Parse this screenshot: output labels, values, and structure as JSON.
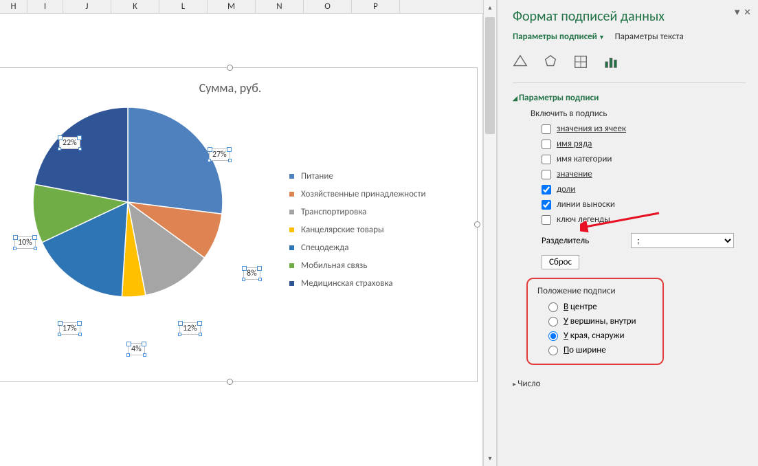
{
  "columns": [
    "H",
    "I",
    "J",
    "K",
    "L",
    "M",
    "N",
    "O",
    "P"
  ],
  "chart_data": {
    "type": "pie",
    "title": "Сумма, руб.",
    "series": [
      {
        "name": "Питание",
        "value": 27,
        "color": "#4e81bd"
      },
      {
        "name": "Хозяйственные принадлежности",
        "value": 8,
        "color": "#dd8452"
      },
      {
        "name": "Транспортировка",
        "value": 12,
        "color": "#a5a5a5"
      },
      {
        "name": "Канцелярские товары",
        "value": 4,
        "color": "#ffc000"
      },
      {
        "name": "Спецодежда",
        "value": 17,
        "color": "#2e75b6"
      },
      {
        "name": "Мобильная связь",
        "value": 10,
        "color": "#70ad47"
      },
      {
        "name": "Медицинская страховка",
        "value": 22,
        "color": "#2f5597"
      }
    ]
  },
  "pane": {
    "title": "Формат подписей данных",
    "tab_active": "Параметры подписей",
    "tab_text": "Параметры текста",
    "section_params": "Параметры подписи",
    "include_label": "Включить в подпись",
    "checks": {
      "values_cells": "значения из ячеек",
      "series_name": "имя ряда",
      "category_name": "имя категории",
      "value": "значение",
      "percent": "доли",
      "leader_lines": "линии выноски",
      "legend_key": "ключ легенды"
    },
    "separator_label": "Разделитель",
    "separator_value": ";",
    "reset": "Сброс",
    "position": {
      "title": "Положение подписи",
      "center": "В центре",
      "inside_end": "У вершины, внутри",
      "outside_end": "У края, снаружи",
      "best_fit": "По ширине"
    },
    "number_section": "Число"
  }
}
